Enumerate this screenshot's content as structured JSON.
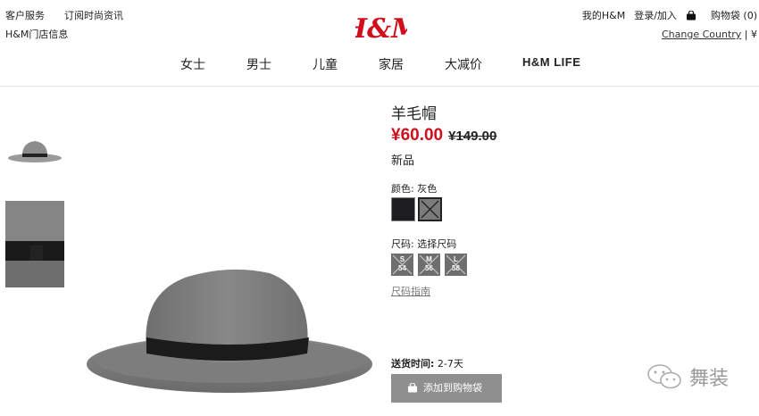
{
  "header": {
    "customer_service": "客户服务",
    "subscribe": "订阅时尚资讯",
    "store_info": "H&M门店信息",
    "logo_text": "H&M",
    "my_account": "我的H&M",
    "login_join": "登录/加入",
    "bag_label": "购物袋 (0)",
    "change_country": "Change Country",
    "currency": " | ¥"
  },
  "nav": {
    "items": [
      "女士",
      "男士",
      "儿童",
      "家居",
      "大减价",
      "H&M LIFE"
    ]
  },
  "product": {
    "title": "羊毛帽",
    "price_current": "¥60.00",
    "price_original": "¥149.00",
    "badge": "新品",
    "color_label": "颜色: 灰色",
    "size_label": "尺码: 选择尺码",
    "sizes": [
      {
        "top": "S",
        "bottom": "54"
      },
      {
        "top": "M",
        "bottom": "56"
      },
      {
        "top": "L",
        "bottom": "58"
      }
    ],
    "size_guide": "尺码指南",
    "delivery_label": "送货时间:",
    "delivery_value": " 2-7天",
    "add_to_bag": "添加到购物袋"
  },
  "watermark": {
    "text": "舞装"
  },
  "colors": {
    "brand_red": "#d00f1c",
    "button_grey": "#8f8f8f"
  },
  "icons": [
    "hm-logo-icon",
    "shopping-bag-icon",
    "crossed-out-icon",
    "wechat-icon"
  ]
}
